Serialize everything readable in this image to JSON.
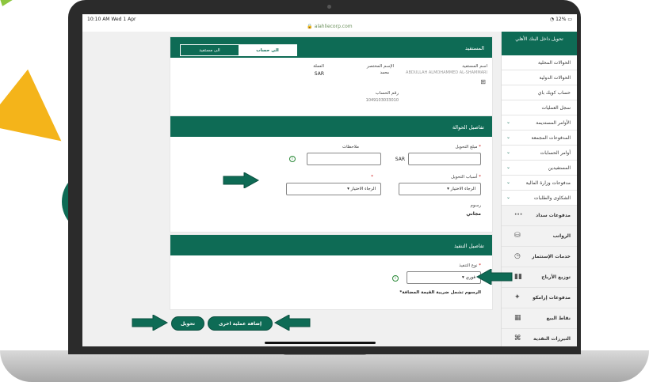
{
  "status": {
    "time": "10:10 AM  Wed 1 Apr",
    "battery": "12%"
  },
  "browser": {
    "url": "alahliecorp.com"
  },
  "sidebar": {
    "header": "تحويل داخل البنك الأهلي",
    "items": [
      {
        "label": "الحوالات المحلية",
        "chevron": false
      },
      {
        "label": "الحوالات الدولية",
        "chevron": false
      },
      {
        "label": "حساب كويك باي",
        "chevron": false
      },
      {
        "label": "سجل العمليات",
        "chevron": false
      },
      {
        "label": "الأوامر المستديمة",
        "chevron": true
      },
      {
        "label": "المدفوعات المجمعة",
        "chevron": true
      },
      {
        "label": "أوامر الحسابات",
        "chevron": true
      },
      {
        "label": "المستفيدين",
        "chevron": true
      },
      {
        "label": "مدفوعات وزارة المالية",
        "chevron": true
      },
      {
        "label": "الشكاوى والطلبات",
        "chevron": true
      }
    ],
    "sections": [
      {
        "label": "مدفوعات سداد",
        "icon": "ellipsis-icon"
      },
      {
        "label": "الرواتب",
        "icon": "payroll-icon"
      },
      {
        "label": "خدمات الإستثمار",
        "icon": "investment-icon"
      },
      {
        "label": "توزيع الأرباح",
        "icon": "chart-icon"
      },
      {
        "label": "مدفوعات إرامكو",
        "icon": "star-icon"
      },
      {
        "label": "نقاط البيع",
        "icon": "pos-icon"
      },
      {
        "label": "التيرزات النقدية",
        "icon": "cash-icon"
      }
    ]
  },
  "beneficiary": {
    "title": "المستفيد",
    "tab_account": "الى حساب",
    "tab_beneficiary": "الى مستفيد",
    "name_label": "اسم المستفيد",
    "name_value": "ABDULLAH ALMOHAMMED AL-SHAMMARI",
    "short_name_label": "الإسم المختصر",
    "short_name_value": "محمد",
    "currency_label": "العملة",
    "currency_value": "SAR",
    "account_label": "رقم الحساب",
    "account_value": "1049103033010"
  },
  "transfer": {
    "title": "تفاصيل الحوالة",
    "amount_label": "مبلغ التحويل",
    "amount_currency": "SAR",
    "notes_label": "ملاحظات",
    "reason_label": "أسباب التحويل",
    "select_placeholder": "الرجاء الاختيار",
    "fees_label": "رسوم",
    "fees_value": "مجاني"
  },
  "execution": {
    "title": "تفاصيل التنفيذ",
    "type_label": "نوع التنفيذ",
    "type_value": "فوري",
    "vat_note": "*الرسوم تشمل ضريبة القيمة المضافة"
  },
  "actions": {
    "transfer": "تحويل",
    "add_another": "إضافة عملية اخرى"
  },
  "colors": {
    "primary": "#0e6b55",
    "arrow": "#0e6b55",
    "accent_green": "#8dc63f",
    "accent_yellow": "#f4b41a"
  }
}
